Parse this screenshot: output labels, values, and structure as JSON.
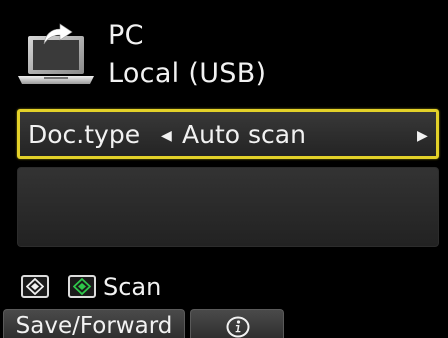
{
  "destination": {
    "icon": "computer-icon",
    "title": "PC",
    "subtitle": "Local (USB)"
  },
  "setting": {
    "label": "Doc.type",
    "value": "Auto scan",
    "highlight_color": "#e3d129"
  },
  "start_keys": {
    "black_icon": "black-start-icon",
    "color_icon": "color-start-icon",
    "color_accent": "#2ec84a",
    "label": "Scan"
  },
  "function_buttons": {
    "left_label": "Save/Forward",
    "middle_icon": "info-icon"
  }
}
